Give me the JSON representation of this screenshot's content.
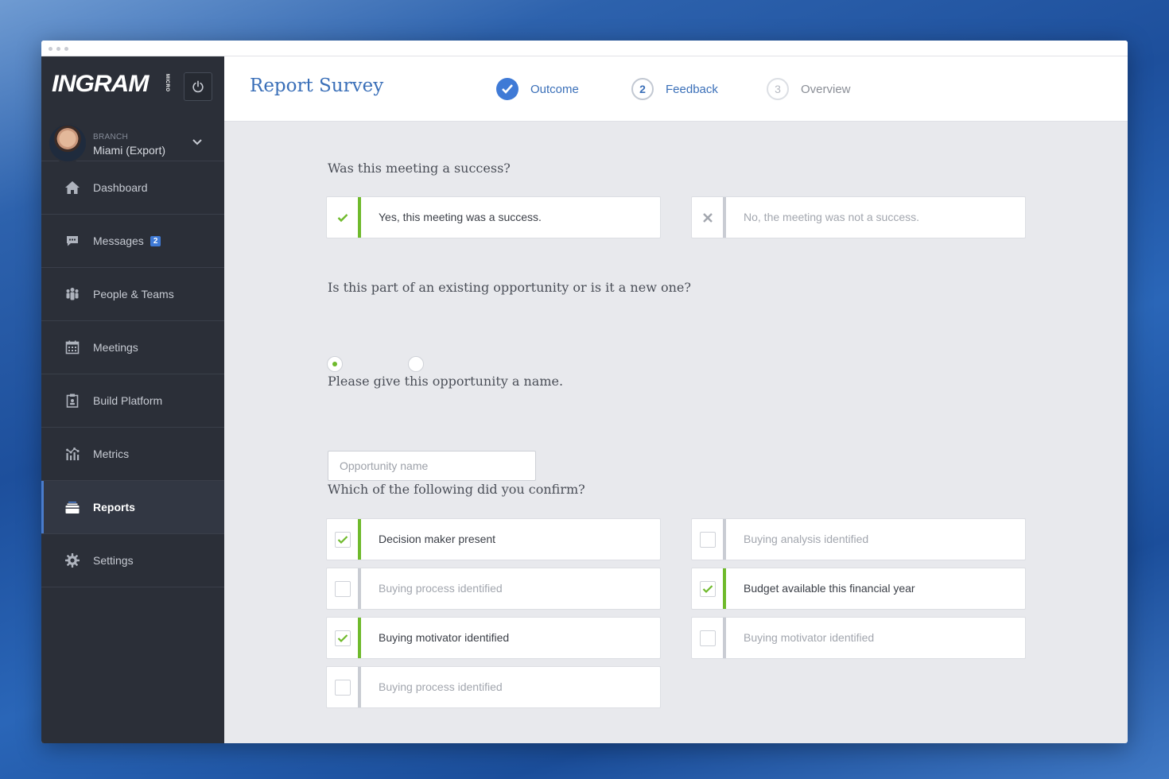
{
  "brand": {
    "logo_text": "INGRAM",
    "logo_sub": "MICRO"
  },
  "branch": {
    "label": "BRANCH",
    "name": "Miami (Export)"
  },
  "nav": [
    {
      "label": "Dashboard",
      "icon": "home-icon"
    },
    {
      "label": "Messages",
      "icon": "message-icon",
      "badge": "2"
    },
    {
      "label": "People & Teams",
      "icon": "people-icon"
    },
    {
      "label": "Meetings",
      "icon": "calendar-icon"
    },
    {
      "label": "Build Platform",
      "icon": "clipboard-icon"
    },
    {
      "label": "Metrics",
      "icon": "metrics-icon"
    },
    {
      "label": "Reports",
      "icon": "reports-icon",
      "active": true
    },
    {
      "label": "Settings",
      "icon": "gear-icon"
    }
  ],
  "header": {
    "title": "Report Survey",
    "steps": [
      {
        "label": "Outcome",
        "state": "done"
      },
      {
        "number": "2",
        "label": "Feedback",
        "state": "current"
      },
      {
        "number": "3",
        "label": "Overview",
        "state": "upcoming"
      }
    ]
  },
  "survey": {
    "q1": "Was this meeting a success?",
    "q1_yes": "Yes, this meeting was a success.",
    "q1_no": "No, the meeting was not a success.",
    "q2": "Is this part of an existing opportunity or is it a new one?",
    "q3": "Please give this opportunity a name.",
    "q3_placeholder": "Opportunity name",
    "q4": "Which of the following did you confirm?",
    "confirm_items": [
      {
        "label": "Decision maker present",
        "checked": true
      },
      {
        "label": "Buying analysis identified",
        "checked": false
      },
      {
        "label": "Buying process identified",
        "checked": false
      },
      {
        "label": "Budget available this financial year",
        "checked": true
      },
      {
        "label": "Buying motivator identified",
        "checked": true
      },
      {
        "label": "Buying motivator identified",
        "checked": false
      },
      {
        "label": "Buying process identified",
        "checked": false
      }
    ]
  },
  "colors": {
    "accent": "#3a6fb8",
    "success": "#6fba2c",
    "sidebar": "#2b2f38"
  }
}
